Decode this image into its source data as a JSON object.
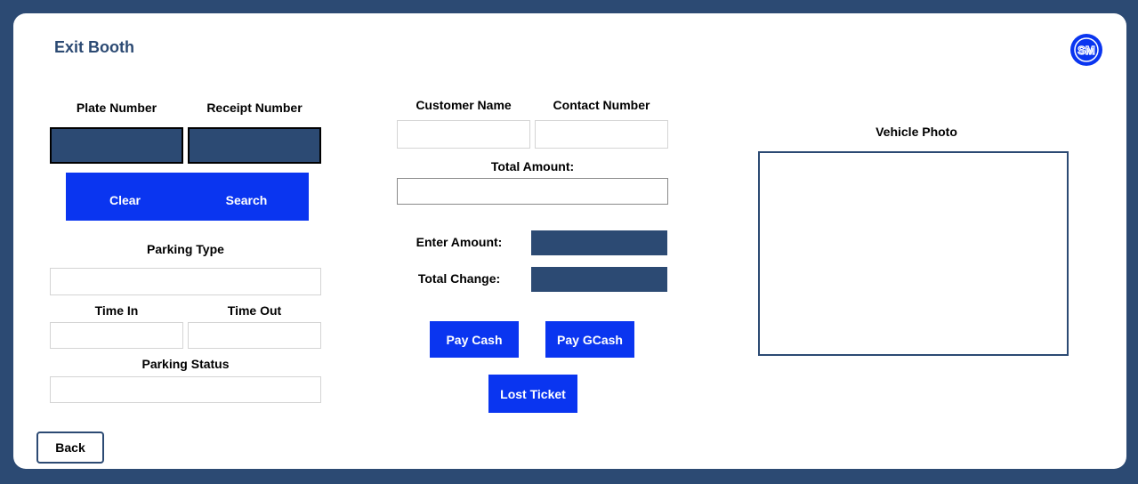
{
  "header": {
    "title": "Exit Booth",
    "logo_icon": "sm-logo-icon",
    "logo_text": "SM"
  },
  "search": {
    "plate_label": "Plate Number",
    "receipt_label": "Receipt Number",
    "plate_value": "",
    "receipt_value": "",
    "clear_label": "Clear",
    "search_label": "Search"
  },
  "parking": {
    "type_label": "Parking Type",
    "type_value": "",
    "time_in_label": "Time In",
    "time_in_value": "",
    "time_out_label": "Time Out",
    "time_out_value": "",
    "status_label": "Parking Status",
    "status_value": ""
  },
  "customer": {
    "name_label": "Customer Name",
    "name_value": "",
    "contact_label": "Contact Number",
    "contact_value": "",
    "total_amount_label": "Total Amount:",
    "total_amount_value": "",
    "enter_amount_label": "Enter Amount:",
    "enter_amount_value": "",
    "total_change_label": "Total Change:",
    "total_change_value": ""
  },
  "payment": {
    "pay_cash_label": "Pay Cash",
    "pay_gcash_label": "Pay GCash",
    "lost_ticket_label": "Lost Ticket"
  },
  "vehicle": {
    "photo_label": "Vehicle Photo"
  },
  "footer": {
    "back_label": "Back"
  },
  "colors": {
    "frame": "#2c4a73",
    "accent_blue": "#0a35f0",
    "panel": "#ffffff"
  }
}
